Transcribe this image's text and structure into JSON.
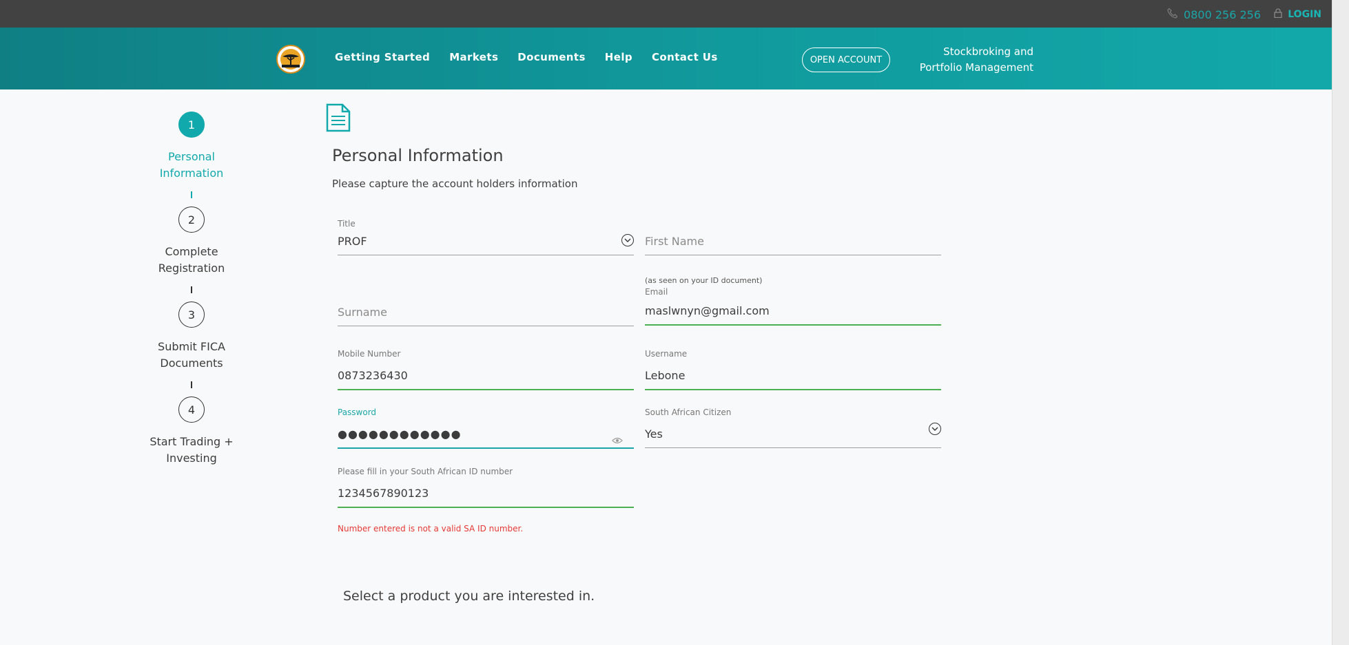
{
  "topbar": {
    "phone": "0800 256 256",
    "login": "LOGIN"
  },
  "nav": {
    "items": [
      "Getting Started",
      "Markets",
      "Documents",
      "Help",
      "Contact Us"
    ],
    "open_account": "OPEN ACCOUNT",
    "tagline_line1": "Stockbroking and",
    "tagline_line2": "Portfolio Management"
  },
  "steps": [
    {
      "num": "1",
      "line1": "Personal",
      "line2": "Information",
      "active": true
    },
    {
      "num": "2",
      "line1": "Complete",
      "line2": "Registration",
      "active": false
    },
    {
      "num": "3",
      "line1": "Submit FICA",
      "line2": "Documents",
      "active": false
    },
    {
      "num": "4",
      "line1": "Start Trading +",
      "line2": "Investing",
      "active": false
    }
  ],
  "form": {
    "title": "Personal Information",
    "subtitle": "Please capture the account holders information",
    "title_field": {
      "label": "Title",
      "value": "PROF"
    },
    "first_name": {
      "placeholder": "First Name"
    },
    "surname": {
      "placeholder": "Surname"
    },
    "email": {
      "hint": "(as seen on your ID document)",
      "label": "Email",
      "value": "maslwnyn@gmail.com"
    },
    "mobile": {
      "label": "Mobile Number",
      "value": "0873236430"
    },
    "username": {
      "label": "Username",
      "value": "Lebone"
    },
    "password": {
      "label": "Password",
      "value": "●●●●●●●●●●●●"
    },
    "citizen": {
      "label": "South African Citizen",
      "value": "Yes"
    },
    "id_number": {
      "label": "Please fill in your South African ID number",
      "value": "1234567890123"
    },
    "error": "Number entered is not a valid SA ID number.",
    "product_prompt": "Select a product you are interested in."
  },
  "colors": {
    "accent": "#12a9ac",
    "valid": "#4caf50",
    "error": "#e53935",
    "topbar": "#424242"
  }
}
